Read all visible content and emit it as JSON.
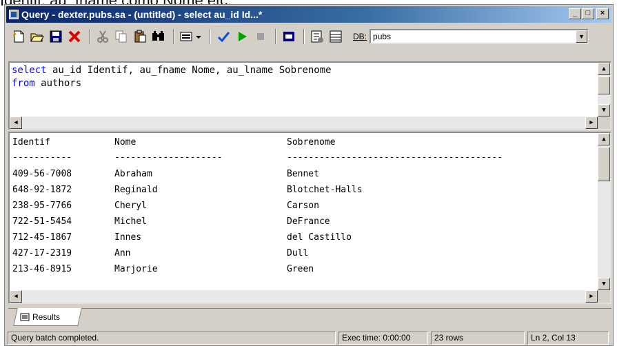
{
  "top_caption": "Identif, au_fname como Nome etc.",
  "window": {
    "title": "Query - dexter.pubs.sa - (untitled) - select au_id Id...*",
    "buttons": {
      "minimize": "_",
      "maximize": "□",
      "close": "×"
    }
  },
  "toolbar": {
    "icons": [
      "new-icon",
      "open-icon",
      "save-icon",
      "delete-icon",
      "cut-icon",
      "copy-icon",
      "paste-icon",
      "find-icon",
      "results-mode-icon",
      "check-icon",
      "execute-icon",
      "stop-icon",
      "plan-icon",
      "options-icon",
      "grid-icon"
    ],
    "db_label": "DB:",
    "db_value": "pubs"
  },
  "editor": {
    "line1_kw": "select",
    "line1_rest": " au_id Identif, au_fname Nome, au_lname Sobrenome",
    "line2_kw": "from",
    "line2_rest": " authors"
  },
  "results": {
    "headers": [
      "Identif",
      "Nome",
      "Sobrenome"
    ],
    "dashes": [
      "-----------",
      "--------------------",
      "----------------------------------------"
    ],
    "rows": [
      [
        "409-56-7008",
        "Abraham",
        "Bennet"
      ],
      [
        "648-92-1872",
        "Reginald",
        "Blotchet-Halls"
      ],
      [
        "238-95-7766",
        "Cheryl",
        "Carson"
      ],
      [
        "722-51-5454",
        "Michel",
        "DeFrance"
      ],
      [
        "712-45-1867",
        "Innes",
        "del Castillo"
      ],
      [
        "427-17-2319",
        "Ann",
        "Dull"
      ],
      [
        "213-46-8915",
        "Marjorie",
        "Green"
      ]
    ]
  },
  "tab": {
    "label": "Results"
  },
  "status": {
    "message": "Query batch completed.",
    "exec_time": "Exec time: 0:00:00",
    "rows": "23 rows",
    "position": "Ln 2, Col 13"
  },
  "colors": {
    "keyword": "#0000ff",
    "titlebar_start": "#0a246a",
    "titlebar_end": "#a6caf0",
    "chrome": "#d4d0c8"
  }
}
